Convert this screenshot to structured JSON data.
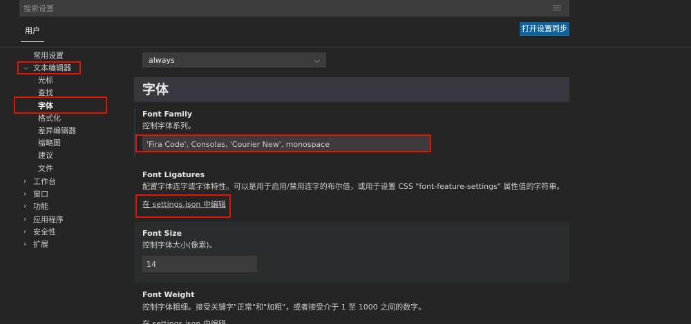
{
  "search": {
    "placeholder": "搜索设置",
    "icon": "filter-icon"
  },
  "tabs": {
    "user": "用户"
  },
  "toolbar": {
    "sync_label": "打开设置同步"
  },
  "tree": {
    "items": [
      {
        "label": "常用设置",
        "expanded": null
      },
      {
        "label": "文本编辑器",
        "expanded": true
      },
      {
        "label": "光标"
      },
      {
        "label": "查找"
      },
      {
        "label": "字体",
        "selected": true
      },
      {
        "label": "格式化"
      },
      {
        "label": "差异编辑器"
      },
      {
        "label": "缩略图"
      },
      {
        "label": "建议"
      },
      {
        "label": "文件"
      },
      {
        "label": "工作台",
        "expanded": false
      },
      {
        "label": "窗口",
        "expanded": false
      },
      {
        "label": "功能",
        "expanded": false
      },
      {
        "label": "应用程序",
        "expanded": false
      },
      {
        "label": "安全性",
        "expanded": false
      },
      {
        "label": "扩展",
        "expanded": false
      }
    ]
  },
  "main": {
    "top_select_value": "always",
    "section_title": "字体",
    "font_family": {
      "title": "Font Family",
      "description": "控制字体系列。",
      "value": "'Fira Code', Consolas, 'Courier New', monospace"
    },
    "font_ligatures": {
      "title": "Font Ligatures",
      "description": "配置字体连字或字体特性。可以是用于启用/禁用连字的布尔值，或用于设置 CSS \"font-feature-settings\" 属性值的字符串。",
      "link": "在 settings.json 中编辑"
    },
    "font_size": {
      "title": "Font Size",
      "description": "控制字体大小(像素)。",
      "value": "14"
    },
    "font_weight": {
      "title": "Font Weight",
      "description": "控制字体粗细。接受关键字\"正常\"和\"加粗\"，或者接受介于 1 至 1000 之间的数字。",
      "link": "在 settings.json 中编辑"
    }
  },
  "colors": {
    "accent": "#0e639c",
    "highlight": "#e51400",
    "background": "#252526"
  }
}
